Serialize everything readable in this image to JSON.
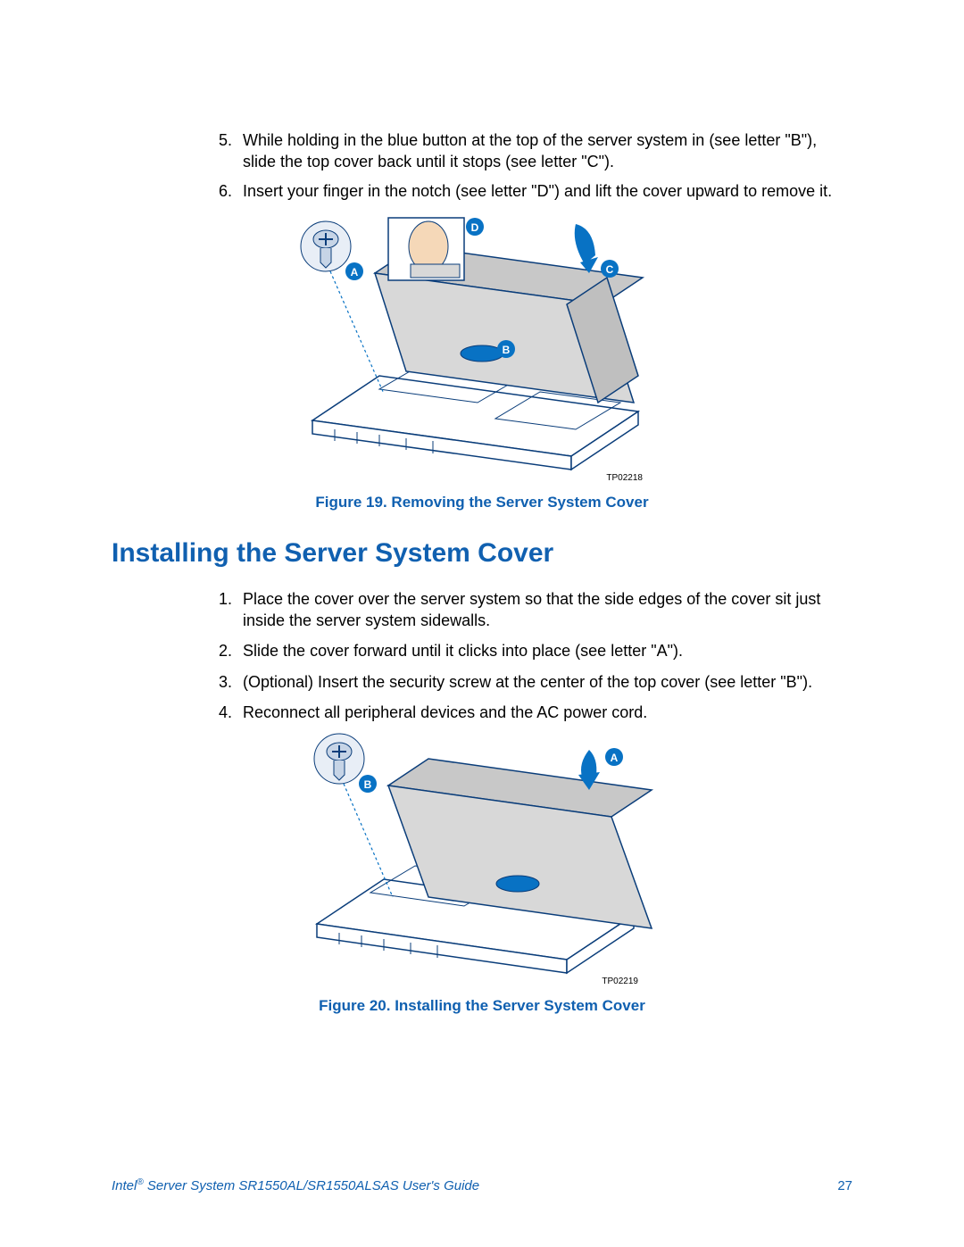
{
  "list1": {
    "items": [
      {
        "n": "5.",
        "text": "While holding in the blue button at the top of the server system in (see letter \"B\"), slide the top cover back until it stops (see letter \"C\")."
      },
      {
        "n": "6.",
        "text": "Insert your finger in the notch (see letter \"D\") and lift the cover upward to remove it."
      }
    ]
  },
  "figure1": {
    "tag": "TP02218",
    "caption": "Figure 19. Removing the Server System Cover",
    "labels": {
      "a": "A",
      "b": "B",
      "c": "C",
      "d": "D"
    }
  },
  "heading": "Installing the Server System Cover",
  "list2": {
    "items": [
      {
        "n": "1.",
        "text": "Place the cover over the server system so that the side edges of the cover sit just inside the server system sidewalls."
      },
      {
        "n": "2.",
        "text": "Slide the cover forward until it clicks into place (see letter \"A\")."
      },
      {
        "n": "3.",
        "text": "(Optional) Insert the security screw at the center of the top cover (see letter \"B\")."
      },
      {
        "n": "4.",
        "text": "Reconnect all peripheral devices and the AC power cord."
      }
    ]
  },
  "figure2": {
    "tag": "TP02219",
    "caption": "Figure 20. Installing the Server System Cover",
    "labels": {
      "a": "A",
      "b": "B"
    }
  },
  "footer": {
    "left_prefix": "Intel",
    "left_reg": "®",
    "left_suffix": " Server System SR1550AL/SR1550ALSAS User's Guide",
    "page": "27"
  },
  "colors": {
    "accent": "#1060b0"
  }
}
